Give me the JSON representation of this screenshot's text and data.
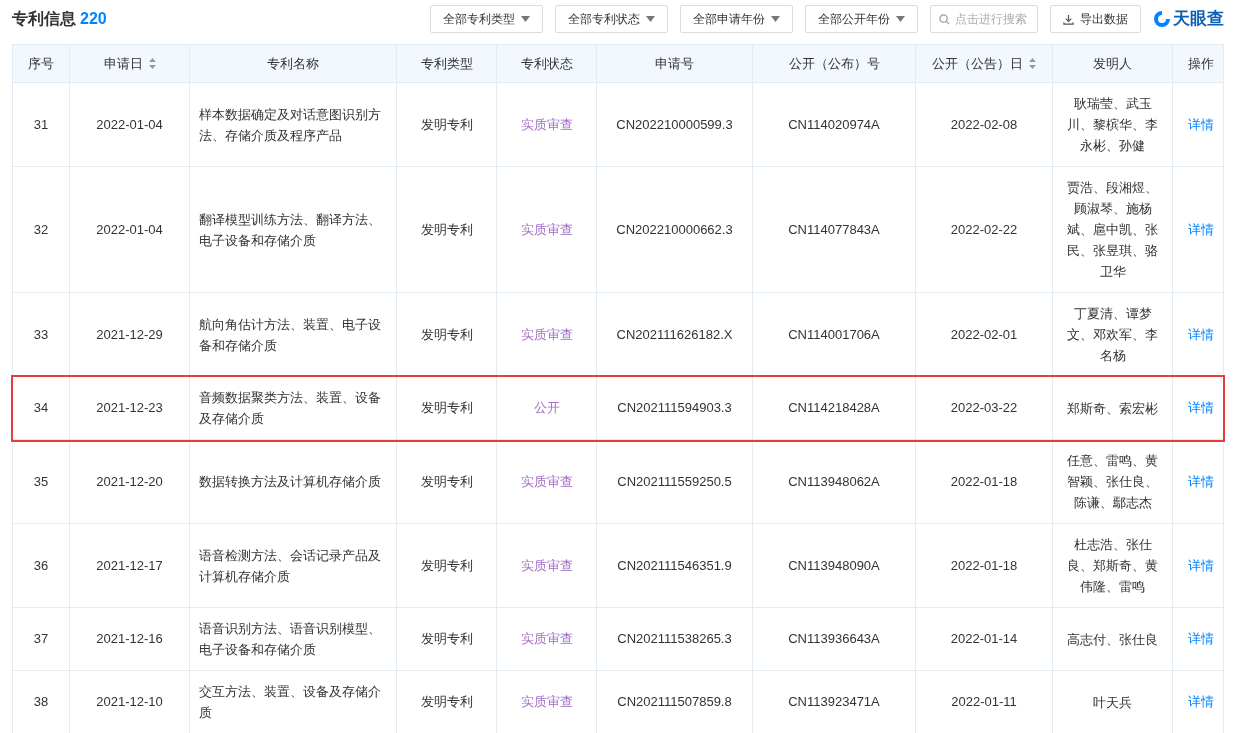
{
  "header": {
    "title": "专利信息",
    "count": "220",
    "filters": [
      "全部专利类型",
      "全部专利状态",
      "全部申请年份",
      "全部公开年份"
    ],
    "search": {
      "placeholder": "点击进行搜索"
    },
    "export_button": "导出数据",
    "logo": "天眼查"
  },
  "table": {
    "columns": [
      {
        "label": "序号",
        "sortable": false
      },
      {
        "label": "申请日",
        "sortable": true
      },
      {
        "label": "专利名称",
        "sortable": false
      },
      {
        "label": "专利类型",
        "sortable": false
      },
      {
        "label": "专利状态",
        "sortable": false
      },
      {
        "label": "申请号",
        "sortable": false
      },
      {
        "label": "公开（公布）号",
        "sortable": false
      },
      {
        "label": "公开（公告）日",
        "sortable": true
      },
      {
        "label": "发明人",
        "sortable": false
      },
      {
        "label": "操作",
        "sortable": false
      }
    ],
    "rows": [
      {
        "index": "31",
        "apply_date": "2022-01-04",
        "name": "样本数据确定及对话意图识别方法、存储介质及程序产品",
        "type": "发明专利",
        "status": "实质审查",
        "application_no": "CN202210000599.3",
        "publication_no": "CN114020974A",
        "publication_date": "2022-02-08",
        "inventors": "耿瑞莹、武玉川、黎槟华、李永彬、孙健",
        "action": "详情",
        "highlighted": false
      },
      {
        "index": "32",
        "apply_date": "2022-01-04",
        "name": "翻译模型训练方法、翻译方法、电子设备和存储介质",
        "type": "发明专利",
        "status": "实质审查",
        "application_no": "CN202210000662.3",
        "publication_no": "CN114077843A",
        "publication_date": "2022-02-22",
        "inventors": "贾浩、段湘煜、顾淑琴、施杨斌、扈中凯、张民、张昱琪、骆卫华",
        "action": "详情",
        "highlighted": false
      },
      {
        "index": "33",
        "apply_date": "2021-12-29",
        "name": "航向角估计方法、装置、电子设备和存储介质",
        "type": "发明专利",
        "status": "实质审查",
        "application_no": "CN202111626182.X",
        "publication_no": "CN114001706A",
        "publication_date": "2022-02-01",
        "inventors": "丁夏清、谭梦文、邓欢军、李名杨",
        "action": "详情",
        "highlighted": false
      },
      {
        "index": "34",
        "apply_date": "2021-12-23",
        "name": "音频数据聚类方法、装置、设备及存储介质",
        "type": "发明专利",
        "status": "公开",
        "application_no": "CN202111594903.3",
        "publication_no": "CN114218428A",
        "publication_date": "2022-03-22",
        "inventors": "郑斯奇、索宏彬",
        "action": "详情",
        "highlighted": true
      },
      {
        "index": "35",
        "apply_date": "2021-12-20",
        "name": "数据转换方法及计算机存储介质",
        "type": "发明专利",
        "status": "实质审查",
        "application_no": "CN202111559250.5",
        "publication_no": "CN113948062A",
        "publication_date": "2022-01-18",
        "inventors": "任意、雷鸣、黄智颖、张仕良、陈谦、鄢志杰",
        "action": "详情",
        "highlighted": false
      },
      {
        "index": "36",
        "apply_date": "2021-12-17",
        "name": "语音检测方法、会话记录产品及计算机存储介质",
        "type": "发明专利",
        "status": "实质审查",
        "application_no": "CN202111546351.9",
        "publication_no": "CN113948090A",
        "publication_date": "2022-01-18",
        "inventors": "杜志浩、张仕良、郑斯奇、黄伟隆、雷鸣",
        "action": "详情",
        "highlighted": false
      },
      {
        "index": "37",
        "apply_date": "2021-12-16",
        "name": "语音识别方法、语音识别模型、电子设备和存储介质",
        "type": "发明专利",
        "status": "实质审查",
        "application_no": "CN202111538265.3",
        "publication_no": "CN113936643A",
        "publication_date": "2022-01-14",
        "inventors": "高志付、张仕良",
        "action": "详情",
        "highlighted": false
      },
      {
        "index": "38",
        "apply_date": "2021-12-10",
        "name": "交互方法、装置、设备及存储介质",
        "type": "发明专利",
        "status": "实质审查",
        "application_no": "CN202111507859.8",
        "publication_no": "CN113923471A",
        "publication_date": "2022-01-11",
        "inventors": "叶天兵",
        "action": "详情",
        "highlighted": false
      }
    ]
  }
}
